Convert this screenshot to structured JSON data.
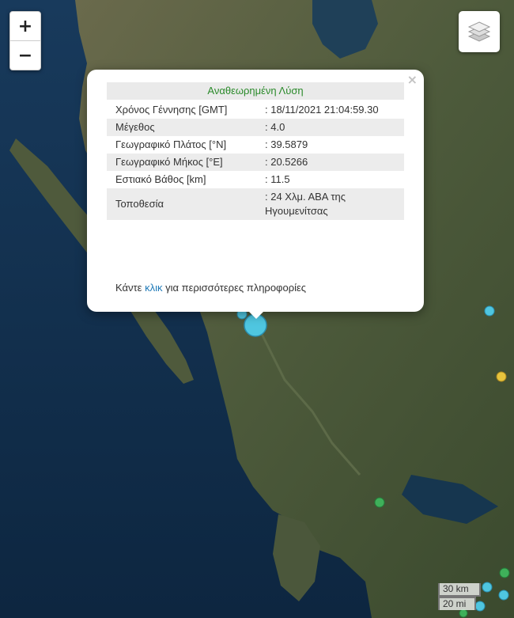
{
  "controls": {
    "zoom_in": "+",
    "zoom_out": "−"
  },
  "popup": {
    "close": "×",
    "title": "Αναθεωρημένη Λύση",
    "rows": [
      {
        "label": "Χρόνος Γέννησης [GMT]",
        "value": ": 18/11/2021 21:04:59.30"
      },
      {
        "label": "Μέγεθος",
        "value": ": 4.0"
      },
      {
        "label": "Γεωγραφικό Πλάτος [°N]",
        "value": ": 39.5879"
      },
      {
        "label": "Γεωγραφικό Μήκος [°E]",
        "value": ": 20.5266"
      },
      {
        "label": "Εστιακό Βάθος [km]",
        "value": ": 11.5"
      },
      {
        "label": "Τοποθεσία",
        "value": ": 24 Χλμ. ΑΒΑ της Ηγουμενίτσας"
      }
    ],
    "more_prefix": "Κάντε ",
    "more_link": "κλικ",
    "more_suffix": " για περισσότερες πληροφορίες"
  },
  "scale": {
    "km": "30 km",
    "mi": "20 mi"
  },
  "colors": {
    "sea": "#0f2a45",
    "land": "#46513a",
    "quake_recent": "#4fc6e0",
    "quake_older_green": "#3fb05a",
    "quake_older_yellow": "#e7c43d"
  }
}
